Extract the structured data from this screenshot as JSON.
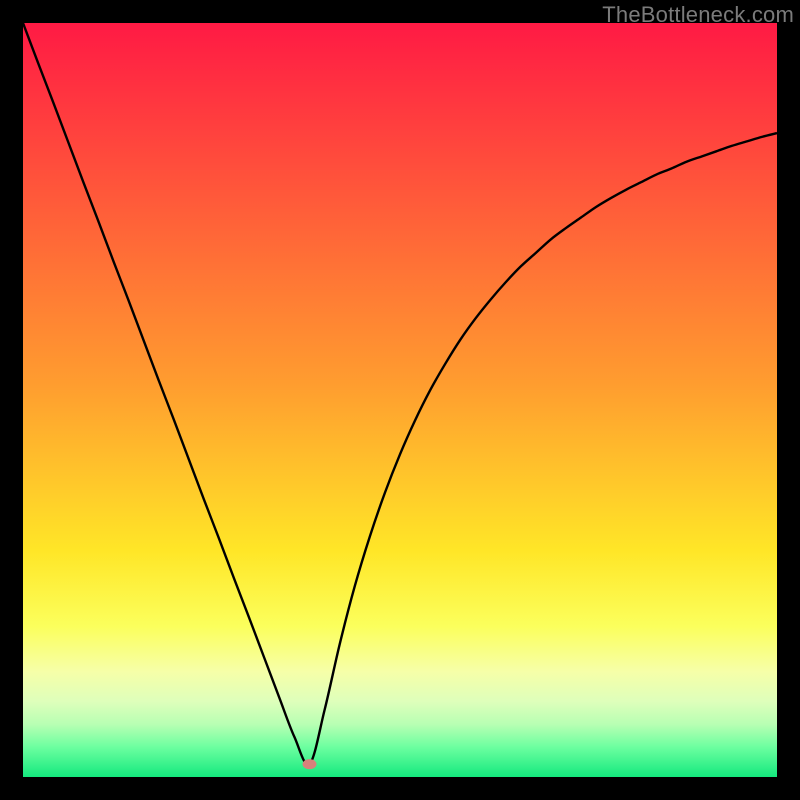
{
  "watermark": "TheBottleneck.com",
  "colors": {
    "grad_top": "#ff1a44",
    "grad_48": "#ff9d2f",
    "grad_70": "#ffe627",
    "grad_80": "#fbff5c",
    "grad_86": "#f6ffa8",
    "grad_90": "#deffbb",
    "grad_93": "#b8ffb3",
    "grad_96": "#6dffa0",
    "grad_bottom": "#14e97e",
    "curve": "#000000",
    "dot": "#d8817b",
    "frame": "#000000"
  },
  "chart_data": {
    "type": "line",
    "title": "",
    "xlabel": "",
    "ylabel": "",
    "xlim": [
      0,
      100
    ],
    "ylim": [
      0,
      100
    ],
    "grid": false,
    "legend": false,
    "vertex_x": 38,
    "vertex_y": 1.7,
    "x": [
      0,
      2,
      4,
      6,
      8,
      10,
      12,
      14,
      16,
      18,
      20,
      22,
      24,
      26,
      28,
      30,
      32,
      34,
      36,
      38,
      40,
      42,
      44,
      46,
      48,
      50,
      52,
      54,
      56,
      58,
      60,
      62,
      64,
      66,
      68,
      70,
      72,
      74,
      76,
      78,
      80,
      82,
      84,
      86,
      88,
      90,
      92,
      94,
      96,
      98,
      100
    ],
    "values": [
      100.0,
      94.7,
      89.5,
      84.2,
      78.9,
      73.7,
      68.4,
      63.2,
      57.9,
      52.6,
      47.4,
      42.1,
      36.8,
      31.6,
      26.3,
      21.1,
      15.8,
      10.5,
      5.3,
      1.7,
      8.9,
      17.6,
      25.3,
      31.9,
      37.7,
      42.8,
      47.3,
      51.3,
      54.8,
      58.0,
      60.8,
      63.3,
      65.6,
      67.7,
      69.5,
      71.3,
      72.8,
      74.2,
      75.6,
      76.8,
      77.9,
      78.9,
      79.9,
      80.7,
      81.6,
      82.3,
      83.0,
      83.7,
      84.3,
      84.9,
      85.4
    ],
    "dot": {
      "x": 38,
      "y": 1.7
    }
  }
}
